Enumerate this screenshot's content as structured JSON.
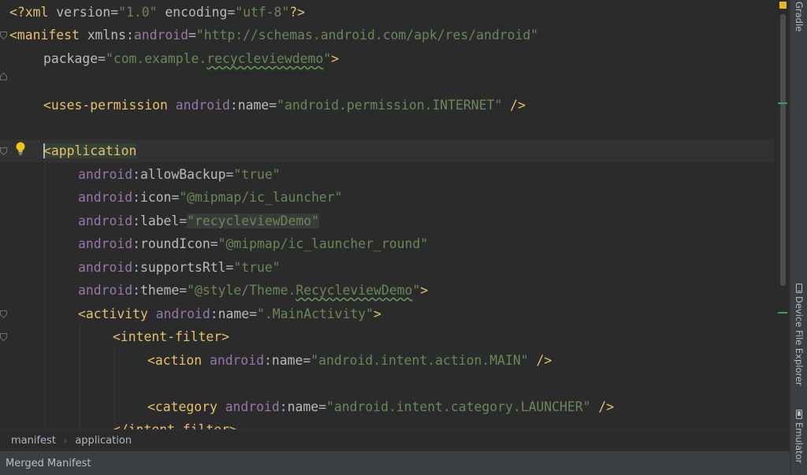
{
  "editor": {
    "lines": {
      "l1": {
        "open": "<?xml ",
        "a1": "version",
        "eq1": "=",
        "v1": "\"1.0\"",
        "a2": " encoding",
        "eq2": "=",
        "v2": "\"utf-8\"",
        "close": "?>"
      },
      "l2": {
        "open": "<manifest ",
        "a1": "xmlns:",
        "ns": "android",
        "eq": "=",
        "v": "\"http://schemas.android.com/apk/res/android\""
      },
      "l3": {
        "a": "package",
        "eq": "=",
        "q1": "\"com.example.",
        "sq": "recycleviewdemo",
        "q2": "\"",
        "close": ">"
      },
      "l5": {
        "open": "<uses-permission ",
        "ns": "android",
        "colon": ":",
        "a": "name",
        "eq": "=",
        "v": "\"android.permission.INTERNET\"",
        "close": " />"
      },
      "l7": {
        "open": "<application"
      },
      "l8": {
        "ns": "android",
        "colon": ":",
        "a": "allowBackup",
        "eq": "=",
        "v": "\"true\""
      },
      "l9": {
        "ns": "android",
        "colon": ":",
        "a": "icon",
        "eq": "=",
        "v": "\"@mipmap/ic_launcher\""
      },
      "l10": {
        "ns": "android",
        "colon": ":",
        "a": "label",
        "eq": "=",
        "v": "\"recycleviewDemo\""
      },
      "l11": {
        "ns": "android",
        "colon": ":",
        "a": "roundIcon",
        "eq": "=",
        "v": "\"@mipmap/ic_launcher_round\""
      },
      "l12": {
        "ns": "android",
        "colon": ":",
        "a": "supportsRtl",
        "eq": "=",
        "v": "\"true\""
      },
      "l13": {
        "ns": "android",
        "colon": ":",
        "a": "theme",
        "eq": "=",
        "q1": "\"@style/Theme.",
        "sq": "RecycleviewDemo",
        "q2": "\"",
        "close": ">"
      },
      "l14": {
        "open": "<activity ",
        "ns": "android",
        "colon": ":",
        "a": "name",
        "eq": "=",
        "v": "\".MainActivity\"",
        "close": ">"
      },
      "l15": {
        "open": "<intent-filter>"
      },
      "l16": {
        "open": "<action ",
        "ns": "android",
        "colon": ":",
        "a": "name",
        "eq": "=",
        "v": "\"android.intent.action.MAIN\"",
        "close": " />"
      },
      "l18": {
        "open": "<category ",
        "ns": "android",
        "colon": ":",
        "a": "name",
        "eq": "=",
        "v": "\"android.intent.category.LAUNCHER\"",
        "close": " />"
      },
      "l19": {
        "open": "</intent-filter>"
      }
    }
  },
  "breadcrumb": {
    "item1": "manifest",
    "separator": "›",
    "item2": "application"
  },
  "bottom_tabs": {
    "merged_manifest": "Merged Manifest"
  },
  "right_toolbar": {
    "gradle": "Gradle",
    "device_file_explorer": "Device File Explorer",
    "emulator": "Emulator"
  },
  "icons": {
    "intention_bulb": "lightbulb-icon",
    "warning": "warning-marker-icon"
  },
  "colors": {
    "tag": "#e8bf6a",
    "namespace": "#9876aa",
    "string_value": "#6a8759",
    "text": "#a9b7c6",
    "background": "#2b2b2b"
  }
}
